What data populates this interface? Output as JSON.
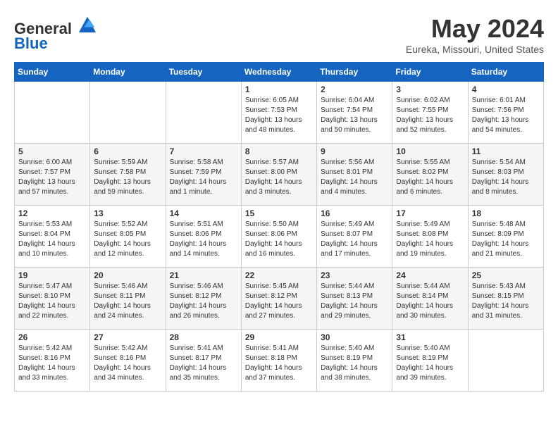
{
  "header": {
    "logo_general": "General",
    "logo_blue": "Blue",
    "month_title": "May 2024",
    "location": "Eureka, Missouri, United States"
  },
  "days_of_week": [
    "Sunday",
    "Monday",
    "Tuesday",
    "Wednesday",
    "Thursday",
    "Friday",
    "Saturday"
  ],
  "weeks": [
    [
      {
        "day": "",
        "info": ""
      },
      {
        "day": "",
        "info": ""
      },
      {
        "day": "",
        "info": ""
      },
      {
        "day": "1",
        "info": "Sunrise: 6:05 AM\nSunset: 7:53 PM\nDaylight: 13 hours\nand 48 minutes."
      },
      {
        "day": "2",
        "info": "Sunrise: 6:04 AM\nSunset: 7:54 PM\nDaylight: 13 hours\nand 50 minutes."
      },
      {
        "day": "3",
        "info": "Sunrise: 6:02 AM\nSunset: 7:55 PM\nDaylight: 13 hours\nand 52 minutes."
      },
      {
        "day": "4",
        "info": "Sunrise: 6:01 AM\nSunset: 7:56 PM\nDaylight: 13 hours\nand 54 minutes."
      }
    ],
    [
      {
        "day": "5",
        "info": "Sunrise: 6:00 AM\nSunset: 7:57 PM\nDaylight: 13 hours\nand 57 minutes."
      },
      {
        "day": "6",
        "info": "Sunrise: 5:59 AM\nSunset: 7:58 PM\nDaylight: 13 hours\nand 59 minutes."
      },
      {
        "day": "7",
        "info": "Sunrise: 5:58 AM\nSunset: 7:59 PM\nDaylight: 14 hours\nand 1 minute."
      },
      {
        "day": "8",
        "info": "Sunrise: 5:57 AM\nSunset: 8:00 PM\nDaylight: 14 hours\nand 3 minutes."
      },
      {
        "day": "9",
        "info": "Sunrise: 5:56 AM\nSunset: 8:01 PM\nDaylight: 14 hours\nand 4 minutes."
      },
      {
        "day": "10",
        "info": "Sunrise: 5:55 AM\nSunset: 8:02 PM\nDaylight: 14 hours\nand 6 minutes."
      },
      {
        "day": "11",
        "info": "Sunrise: 5:54 AM\nSunset: 8:03 PM\nDaylight: 14 hours\nand 8 minutes."
      }
    ],
    [
      {
        "day": "12",
        "info": "Sunrise: 5:53 AM\nSunset: 8:04 PM\nDaylight: 14 hours\nand 10 minutes."
      },
      {
        "day": "13",
        "info": "Sunrise: 5:52 AM\nSunset: 8:05 PM\nDaylight: 14 hours\nand 12 minutes."
      },
      {
        "day": "14",
        "info": "Sunrise: 5:51 AM\nSunset: 8:06 PM\nDaylight: 14 hours\nand 14 minutes."
      },
      {
        "day": "15",
        "info": "Sunrise: 5:50 AM\nSunset: 8:06 PM\nDaylight: 14 hours\nand 16 minutes."
      },
      {
        "day": "16",
        "info": "Sunrise: 5:49 AM\nSunset: 8:07 PM\nDaylight: 14 hours\nand 17 minutes."
      },
      {
        "day": "17",
        "info": "Sunrise: 5:49 AM\nSunset: 8:08 PM\nDaylight: 14 hours\nand 19 minutes."
      },
      {
        "day": "18",
        "info": "Sunrise: 5:48 AM\nSunset: 8:09 PM\nDaylight: 14 hours\nand 21 minutes."
      }
    ],
    [
      {
        "day": "19",
        "info": "Sunrise: 5:47 AM\nSunset: 8:10 PM\nDaylight: 14 hours\nand 22 minutes."
      },
      {
        "day": "20",
        "info": "Sunrise: 5:46 AM\nSunset: 8:11 PM\nDaylight: 14 hours\nand 24 minutes."
      },
      {
        "day": "21",
        "info": "Sunrise: 5:46 AM\nSunset: 8:12 PM\nDaylight: 14 hours\nand 26 minutes."
      },
      {
        "day": "22",
        "info": "Sunrise: 5:45 AM\nSunset: 8:12 PM\nDaylight: 14 hours\nand 27 minutes."
      },
      {
        "day": "23",
        "info": "Sunrise: 5:44 AM\nSunset: 8:13 PM\nDaylight: 14 hours\nand 29 minutes."
      },
      {
        "day": "24",
        "info": "Sunrise: 5:44 AM\nSunset: 8:14 PM\nDaylight: 14 hours\nand 30 minutes."
      },
      {
        "day": "25",
        "info": "Sunrise: 5:43 AM\nSunset: 8:15 PM\nDaylight: 14 hours\nand 31 minutes."
      }
    ],
    [
      {
        "day": "26",
        "info": "Sunrise: 5:42 AM\nSunset: 8:16 PM\nDaylight: 14 hours\nand 33 minutes."
      },
      {
        "day": "27",
        "info": "Sunrise: 5:42 AM\nSunset: 8:16 PM\nDaylight: 14 hours\nand 34 minutes."
      },
      {
        "day": "28",
        "info": "Sunrise: 5:41 AM\nSunset: 8:17 PM\nDaylight: 14 hours\nand 35 minutes."
      },
      {
        "day": "29",
        "info": "Sunrise: 5:41 AM\nSunset: 8:18 PM\nDaylight: 14 hours\nand 37 minutes."
      },
      {
        "day": "30",
        "info": "Sunrise: 5:40 AM\nSunset: 8:19 PM\nDaylight: 14 hours\nand 38 minutes."
      },
      {
        "day": "31",
        "info": "Sunrise: 5:40 AM\nSunset: 8:19 PM\nDaylight: 14 hours\nand 39 minutes."
      },
      {
        "day": "",
        "info": ""
      }
    ]
  ]
}
